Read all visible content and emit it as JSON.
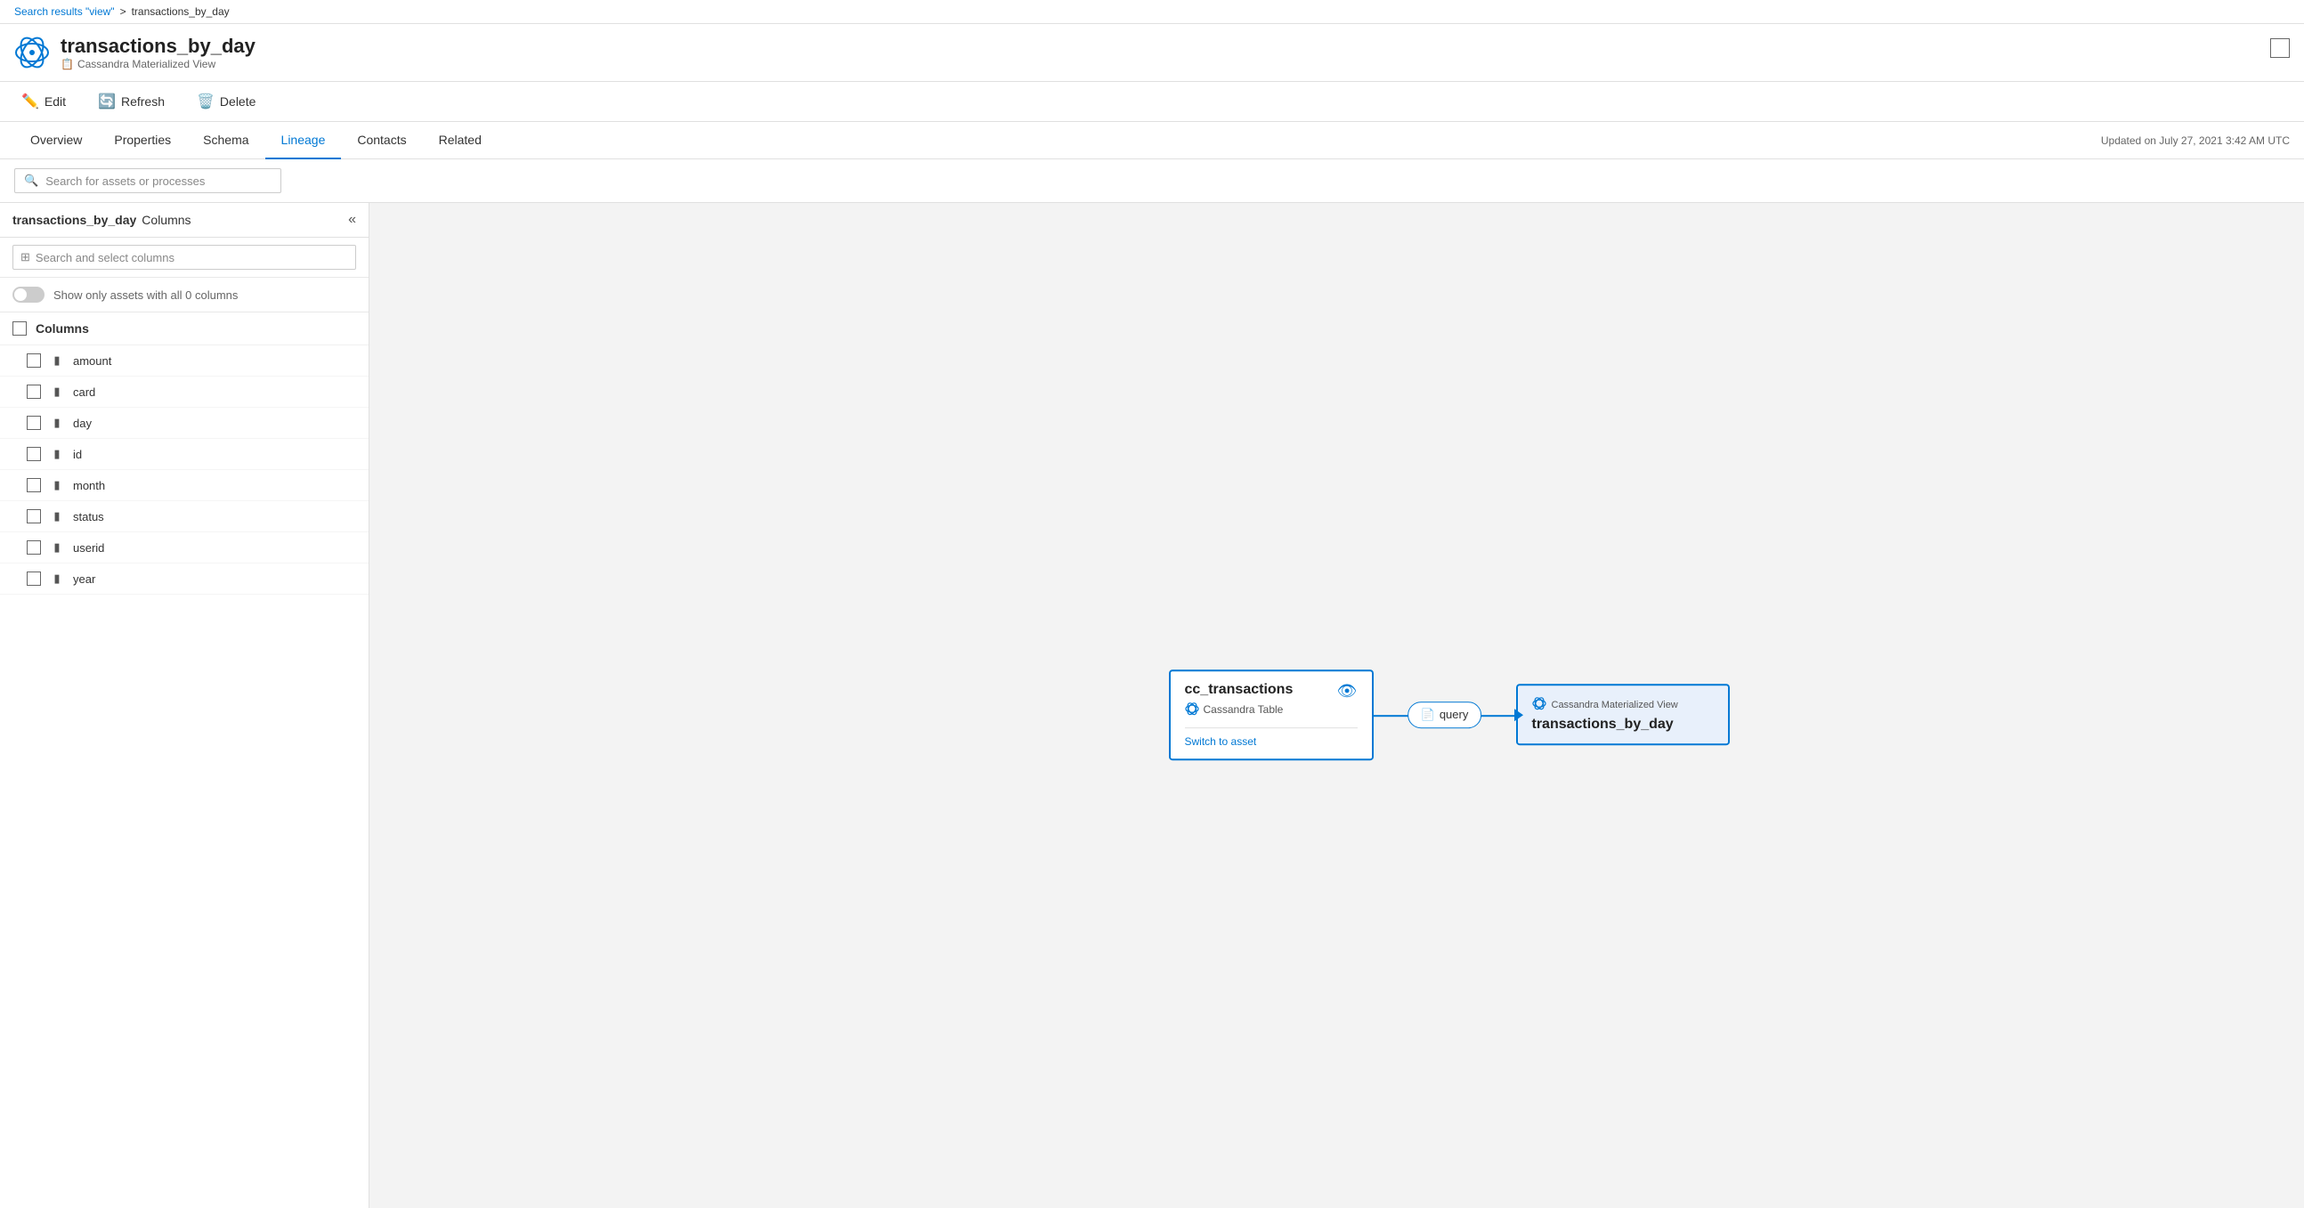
{
  "breadcrumb": {
    "link_text": "Search results \"view\"",
    "separator": ">",
    "current": "transactions_by_day"
  },
  "header": {
    "title": "transactions_by_day",
    "subtitle": "Cassandra Materialized View",
    "subtitle_icon": "📋"
  },
  "toolbar": {
    "edit_label": "Edit",
    "refresh_label": "Refresh",
    "delete_label": "Delete"
  },
  "tabs": [
    {
      "label": "Overview",
      "active": false
    },
    {
      "label": "Properties",
      "active": false
    },
    {
      "label": "Schema",
      "active": false
    },
    {
      "label": "Lineage",
      "active": true
    },
    {
      "label": "Contacts",
      "active": false
    },
    {
      "label": "Related",
      "active": false
    }
  ],
  "updated_text": "Updated on July 27, 2021 3:42 AM UTC",
  "search_placeholder": "Search for assets or processes",
  "left_panel": {
    "title_bold": "transactions_by_day",
    "title_suffix": "Columns",
    "col_search_placeholder": "Search and select columns",
    "toggle_label": "Show only assets with all 0 columns",
    "columns_header": "Columns",
    "columns": [
      {
        "name": "amount"
      },
      {
        "name": "card"
      },
      {
        "name": "day"
      },
      {
        "name": "id"
      },
      {
        "name": "month"
      },
      {
        "name": "status"
      },
      {
        "name": "userid"
      },
      {
        "name": "year"
      }
    ]
  },
  "diagram": {
    "source_node": {
      "title": "cc_transactions",
      "subtitle": "Cassandra Table",
      "switch_label": "Switch to asset",
      "eye_icon": "👁"
    },
    "process_node": {
      "label": "query",
      "icon": "📄"
    },
    "target_node": {
      "header": "Cassandra Materialized View",
      "title": "transactions_by_day"
    }
  }
}
